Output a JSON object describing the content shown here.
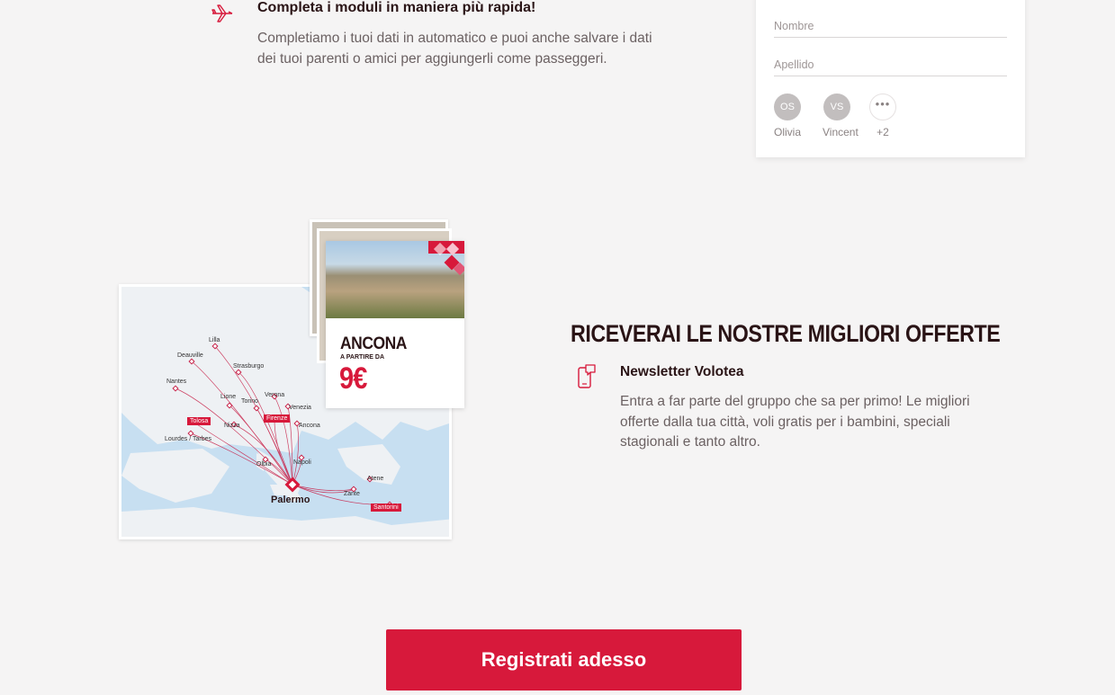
{
  "feature": {
    "icon": "airplane-icon",
    "title": "Completa i moduli in maniera più rapida!",
    "text": "Completiamo i tuoi dati in automatico e puoi anche salvare i dati dei tuoi parenti o amici per aggiungerli come passeggeri."
  },
  "form": {
    "nombre_placeholder": "Nombre",
    "apellido_placeholder": "Apellido",
    "passengers": [
      {
        "initials": "OS",
        "name": "Olivia"
      },
      {
        "initials": "VS",
        "name": "Vincent"
      },
      {
        "initials": "•••",
        "name": "+2"
      }
    ]
  },
  "illustration": {
    "card_city": "ANCONA",
    "card_sub": "A PARTIRE DA",
    "card_price": "9€",
    "map_labels": [
      "Lilla",
      "Deauville",
      "Strasburgo",
      "Nantes",
      "Lione",
      "Torino",
      "Verona",
      "Venezia",
      "Nizza",
      "Ancona",
      "Lourdes / Tarbes",
      "Olbia",
      "Napoli",
      "Atene",
      "Zante"
    ],
    "map_tags": [
      "Tolosa",
      "Firenze",
      "Santorini"
    ],
    "map_hub": "Palermo"
  },
  "offers": {
    "title": "RICEVERAI LE NOSTRE MIGLIORI OFFERTE",
    "icon": "mobile-newsletter-icon",
    "newsletter_title": "Newsletter Volotea",
    "newsletter_text": "Entra a far parte del gruppo che sa per primo! Le migliori offerte dalla tua città, voli gratis per i bambini, speciali stagionali e tanto altro."
  },
  "cta": {
    "label": "Registrati adesso"
  },
  "colors": {
    "brand": "#d7193b",
    "background": "#f5f4f4",
    "heading": "#2a1416",
    "body_text": "#6b6162"
  }
}
